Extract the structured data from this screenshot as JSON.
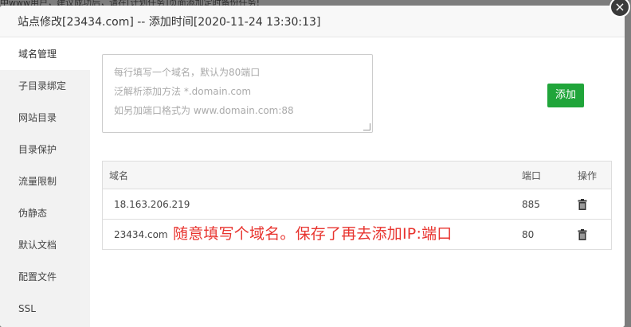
{
  "background": {
    "top_text": "中www用户，建议成功后，请在[计划任务]页面添加定时备份任务!"
  },
  "dialog": {
    "title": "站点修改[23434.com] -- 添加时间[2020-11-24 13:30:13]",
    "close_label": "×"
  },
  "sidebar": {
    "items": [
      {
        "label": "域名管理",
        "active": true
      },
      {
        "label": "子目录绑定"
      },
      {
        "label": "网站目录"
      },
      {
        "label": "目录保护"
      },
      {
        "label": "流量限制"
      },
      {
        "label": "伪静态"
      },
      {
        "label": "默认文档"
      },
      {
        "label": "配置文件"
      },
      {
        "label": "SSL"
      }
    ]
  },
  "domain_input": {
    "placeholder_lines": [
      "每行填写一个域名，默认为80端口",
      "泛解析添加方法 *.domain.com",
      "如另加端口格式为 www.domain.com:88"
    ]
  },
  "add_button": {
    "label": "添加",
    "color": "#20a53a"
  },
  "table": {
    "headers": {
      "domain": "域名",
      "port": "端口",
      "op": "操作"
    },
    "rows": [
      {
        "domain": "18.163.206.219",
        "port": "885",
        "op_icon": "trash-icon"
      },
      {
        "domain": "23434.com",
        "port": "80",
        "op_icon": "trash-icon"
      }
    ]
  },
  "annotation": {
    "text": "随意填写个域名。保存了再去添加IP:端口",
    "color": "#e8342f"
  }
}
